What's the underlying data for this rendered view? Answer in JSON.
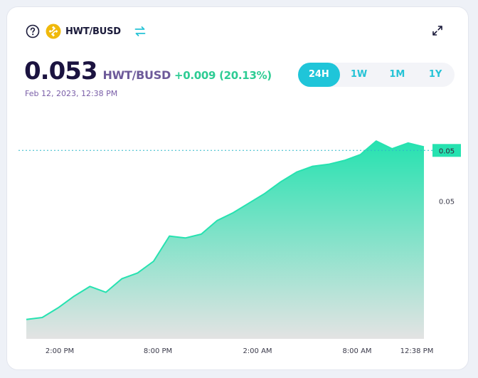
{
  "header": {
    "pair": "HWT/BUSD"
  },
  "price": {
    "value": "0.053",
    "pair": "HWT/BUSD",
    "change": "+0.009 (20.13%)",
    "timestamp": "Feb 12, 2023, 12:38 PM"
  },
  "ranges": [
    {
      "label": "24H",
      "active": true
    },
    {
      "label": "1W",
      "active": false
    },
    {
      "label": "1M",
      "active": false
    },
    {
      "label": "1Y",
      "active": false
    }
  ],
  "colors": {
    "accent": "#1fc5d9",
    "line": "#26e2b0",
    "positive": "#2ecc94",
    "coin": "#f0b90b"
  },
  "icons": [
    "help-icon",
    "busd-coin-icon",
    "swap-icon",
    "expand-icon"
  ],
  "chart_data": {
    "type": "area",
    "x_ticks": [
      "2:00 PM",
      "8:00 PM",
      "2:00 AM",
      "8:00 AM",
      "12:38 PM"
    ],
    "y_ticks": [
      "0.05",
      "0.05"
    ],
    "current_label": "0.05",
    "values": [
      0.0442,
      0.0443,
      0.0448,
      0.0454,
      0.0459,
      0.0456,
      0.0463,
      0.0466,
      0.0472,
      0.0485,
      0.0484,
      0.0486,
      0.0493,
      0.0497,
      0.0502,
      0.0507,
      0.0513,
      0.0518,
      0.0521,
      0.0522,
      0.0524,
      0.0527,
      0.0534,
      0.053,
      0.0533,
      0.0531
    ],
    "ylim": [
      0.0432,
      0.0548
    ]
  }
}
